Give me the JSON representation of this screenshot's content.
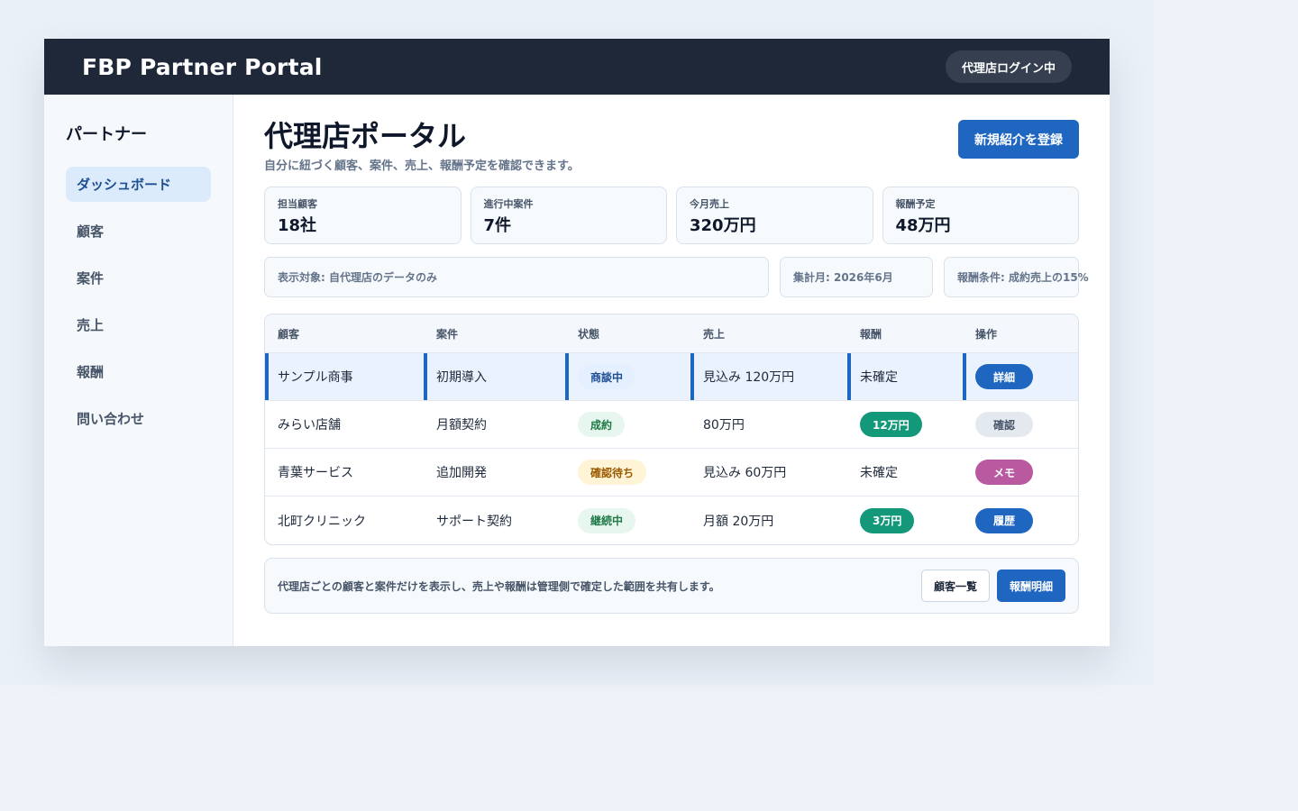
{
  "header": {
    "app_title": "FBP Partner Portal",
    "login_status": "代理店ログイン中"
  },
  "sidebar": {
    "heading": "パートナー",
    "items": [
      {
        "label": "ダッシュボード",
        "active": true
      },
      {
        "label": "顧客"
      },
      {
        "label": "案件"
      },
      {
        "label": "売上"
      },
      {
        "label": "報酬"
      },
      {
        "label": "問い合わせ"
      }
    ]
  },
  "page": {
    "title": "代理店ポータル",
    "subtitle": "自分に紐づく顧客、案件、売上、報酬予定を確認できます。",
    "primary_action": "新規紹介を登録"
  },
  "stats": [
    {
      "label": "担当顧客",
      "value": "18社"
    },
    {
      "label": "進行中案件",
      "value": "7件"
    },
    {
      "label": "今月売上",
      "value": "320万円"
    },
    {
      "label": "報酬予定",
      "value": "48万円"
    }
  ],
  "info": {
    "scope": "表示対象: 自代理店のデータのみ",
    "month": "集計月: 2026年6月",
    "reward_rule": "報酬条件: 成約売上の15%"
  },
  "table": {
    "headers": [
      "顧客",
      "案件",
      "状態",
      "売上",
      "報酬",
      "操作"
    ],
    "rows": [
      {
        "customer": "サンプル商事",
        "deal": "初期導入",
        "status": "商談中",
        "sales": "見込み 120万円",
        "reward": "未確定",
        "action": "詳細"
      },
      {
        "customer": "みらい店舗",
        "deal": "月額契約",
        "status": "成約",
        "sales": "80万円",
        "reward": "12万円",
        "action": "確認"
      },
      {
        "customer": "青葉サービス",
        "deal": "追加開発",
        "status": "確認待ち",
        "sales": "見込み 60万円",
        "reward": "未確定",
        "action": "メモ"
      },
      {
        "customer": "北町クリニック",
        "deal": "サポート契約",
        "status": "継続中",
        "sales": "月額 20万円",
        "reward": "3万円",
        "action": "履歴"
      }
    ]
  },
  "footer": {
    "note": "代理店ごとの顧客と案件だけを表示し、売上や報酬は管理側で確定した範囲を共有します。",
    "customer_list_button": "顧客一覧",
    "reward_detail_button": "報酬明細"
  }
}
